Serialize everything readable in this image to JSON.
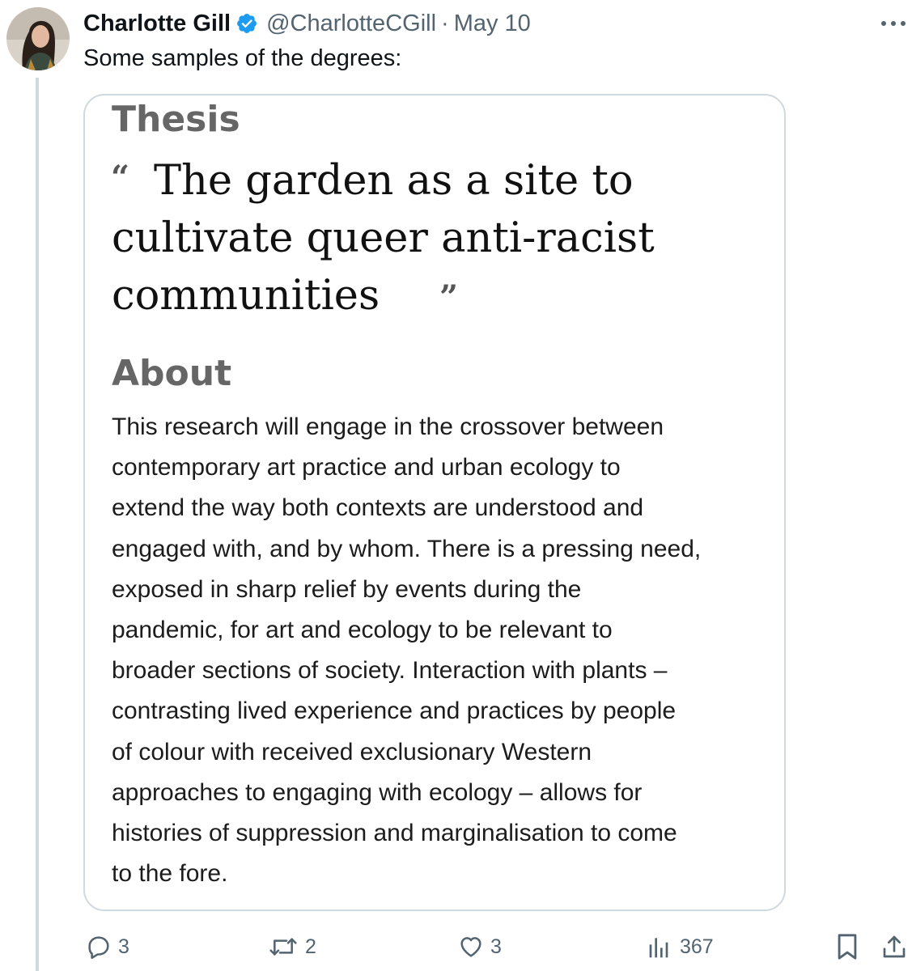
{
  "author": {
    "name": "Charlotte Gill",
    "handle": "@CharlotteCGill",
    "separator": "·",
    "date": "May 10"
  },
  "tweet": {
    "text": "Some samples of the degrees:"
  },
  "card": {
    "thesis_label": "Thesis",
    "quote_open": "“",
    "quote_close": "”",
    "thesis_title_lines": [
      "The garden as a site to",
      "cultivate queer anti-racist",
      "communities"
    ],
    "about_label": "About",
    "about_lines": [
      "This research will engage in the crossover between",
      "contemporary art practice and urban ecology to",
      "extend the way both contexts are understood and",
      "engaged with, and by whom. There is a pressing need,",
      "exposed in sharp relief by events during the",
      "pandemic, for art and ecology to be relevant to",
      "broader sections of society. Interaction with plants –",
      "contrasting lived experience and practices by people",
      "of colour with received exclusionary Western",
      "approaches to engaging with ecology – allows for",
      "histories of suppression and marginalisation to come",
      "to the fore."
    ]
  },
  "actions": {
    "replies": "3",
    "reposts": "2",
    "likes": "3",
    "views": "367"
  },
  "icons": {
    "verified": "verified-badge-icon",
    "more": "more-icon",
    "reply": "reply-icon",
    "repost": "repost-icon",
    "like": "like-icon",
    "views": "views-icon",
    "bookmark": "bookmark-icon",
    "share": "share-icon"
  },
  "colors": {
    "verified": "#1d9bf0",
    "secondary_text": "#536471",
    "border": "#cfd9de",
    "card_label": "#666666"
  }
}
